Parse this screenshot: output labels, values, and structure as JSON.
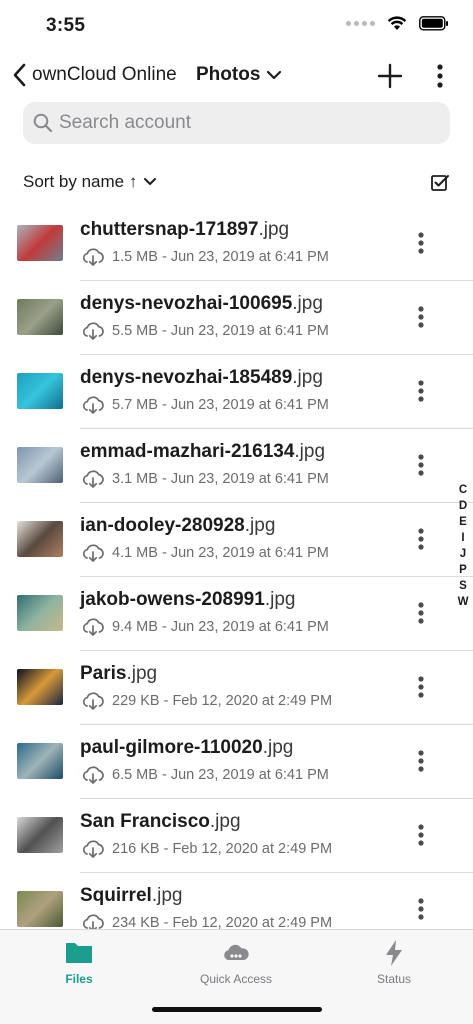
{
  "status_bar": {
    "time": "3:55"
  },
  "nav": {
    "back_label": "ownCloud Online",
    "title": "Photos",
    "icons": {
      "back": "chevron-left-icon",
      "title_menu": "chevron-down-icon",
      "add": "plus-icon",
      "more": "more-vertical-icon"
    }
  },
  "search": {
    "placeholder": "Search account",
    "value": ""
  },
  "sort": {
    "label": "Sort by name ↑",
    "icon": "chevron-down-icon",
    "select_icon": "checkbox-checked-icon"
  },
  "files": [
    {
      "base": "chuttersnap-171897",
      "ext": ".jpg",
      "meta": "1.5 MB - Jun 23, 2019 at 6:41 PM",
      "thumb_colors": [
        "#a9b3bc",
        "#c23b3b",
        "#6f7e8d"
      ]
    },
    {
      "base": "denys-nevozhai-100695",
      "ext": ".jpg",
      "meta": "5.5 MB - Jun 23, 2019 at 6:41 PM",
      "thumb_colors": [
        "#6c7a5c",
        "#9aa08a",
        "#3c4a3a"
      ]
    },
    {
      "base": "denys-nevozhai-185489",
      "ext": ".jpg",
      "meta": "5.7 MB - Jun 23, 2019 at 6:41 PM",
      "thumb_colors": [
        "#1e9fbf",
        "#36c4dc",
        "#0f6e8c"
      ]
    },
    {
      "base": "emmad-mazhari-216134",
      "ext": ".jpg",
      "meta": "3.1 MB - Jun 23, 2019 at 6:41 PM",
      "thumb_colors": [
        "#7d96ad",
        "#b9c7d4",
        "#4d6075"
      ]
    },
    {
      "base": "ian-dooley-280928",
      "ext": ".jpg",
      "meta": "4.1 MB - Jun 23, 2019 at 6:41 PM",
      "thumb_colors": [
        "#e4e2dd",
        "#5a4a40",
        "#b08060"
      ]
    },
    {
      "base": "jakob-owens-208991",
      "ext": ".jpg",
      "meta": "9.4 MB - Jun 23, 2019 at 6:41 PM",
      "thumb_colors": [
        "#2f6f73",
        "#8fb3a0",
        "#c9b98a"
      ]
    },
    {
      "base": "Paris",
      "ext": ".jpg",
      "meta": "229 KB - Feb 12, 2020 at 2:49 PM",
      "thumb_colors": [
        "#0c1020",
        "#d89a3a",
        "#1a2440"
      ]
    },
    {
      "base": "paul-gilmore-110020",
      "ext": ".jpg",
      "meta": "6.5 MB - Jun 23, 2019 at 6:41 PM",
      "thumb_colors": [
        "#2a6a8a",
        "#9fb4b8",
        "#184c68"
      ]
    },
    {
      "base": "San Francisco",
      "ext": ".jpg",
      "meta": "216 KB - Feb 12, 2020 at 2:49 PM",
      "thumb_colors": [
        "#d8d8d8",
        "#505050",
        "#a0a0a0"
      ]
    },
    {
      "base": "Squirrel",
      "ext": ".jpg",
      "meta": "234 KB - Feb 12, 2020 at 2:49 PM",
      "thumb_colors": [
        "#7a8a50",
        "#b0a080",
        "#4a5a30"
      ]
    }
  ],
  "index_letters": [
    "C",
    "D",
    "E",
    "I",
    "J",
    "P",
    "S",
    "W"
  ],
  "tabs": [
    {
      "label": "Files",
      "icon": "folder-icon",
      "active": true
    },
    {
      "label": "Quick Access",
      "icon": "cloud-icon",
      "active": false
    },
    {
      "label": "Status",
      "icon": "bolt-icon",
      "active": false
    }
  ],
  "colors": {
    "accent": "#1b9e8f",
    "text": "#1c1c1e",
    "secondary_text": "#6b6b70",
    "search_bg": "#eeeeef"
  }
}
